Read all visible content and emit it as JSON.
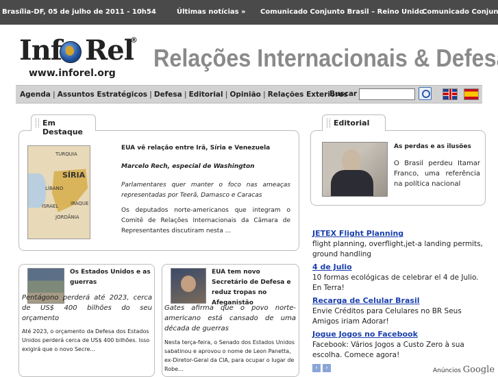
{
  "topbar": {
    "date": "Brasília-DF, 05 de julho de 2011 - 10h54",
    "ultimas": "Últimas notícias »",
    "news1": "Comunicado Conjunto Brasil – Reino Unido",
    "news2": "Comunicado Conjunto"
  },
  "header": {
    "logo_text": "InfoRel",
    "logo_reg": "®",
    "logo_url": "www.inforel.org",
    "title": "Relações Internacionais & Defesa"
  },
  "nav": {
    "items": [
      "Agenda",
      "Assuntos Estratégicos",
      "Defesa",
      "Editorial",
      "Opinião",
      "Relações Exteriores"
    ],
    "search_label": "Buscar",
    "search_value": ""
  },
  "destaque": {
    "tab": "Em Destaque",
    "map_labels": {
      "turquia": "TURQUIA",
      "siria": "SÍRIA",
      "libano": "LÍBANO",
      "israel": "ISRAEL",
      "iraque": "IRAQUE",
      "jordania": "JORDÂNIA"
    },
    "headline": "EUA vê relação entre Irã, Síria e Venezuela",
    "author": "Marcelo Rech, especial de Washington",
    "lead": "Parlamentares quer manter o foco nas ameaças representadas por Teerã, Damasco e Caracas",
    "body": "Os deputados norte-americanos que integram o Comitê de Relações Internacionais da Câmara de Representantes discutiram nesta ..."
  },
  "editorial": {
    "tab": "Editorial",
    "headline": "As perdas e as ilusões",
    "body": "O Brasil perdeu Itamar Franco, uma referência na política nacional"
  },
  "card1": {
    "headline": "Os Estados Unidos e as guerras",
    "lead": "Pentágono perderá até 2023, cerca de US$ 400 bilhões do seu orçamento",
    "body": "Até 2023, o orçamento da Defesa dos Estados Unidos perderá cerca de US$ 400 bilhões. Isso exigirá que o novo Secre..."
  },
  "card2": {
    "headline": "EUA tem novo Secretário de Defesa e reduz tropas no Afeganistão",
    "lead": "Gates afirma que o povo norte-americano está cansado de uma década de guerras",
    "body": "Nesta terça-feira, o Senado dos Estados Unidos sabatinou e aprovou o nome de Leon Panetta, ex-Diretor-Geral da CIA, para ocupar o lugar de Robe..."
  },
  "ads": [
    {
      "title": "JETEX Flight Planning",
      "desc": "flight planning, overflight,jet-a landing permits, ground handling"
    },
    {
      "title": "4 de Julio",
      "desc": "10 formas ecológicas de celebrar el 4 de Julio. En Terra!"
    },
    {
      "title": "Recarga de Celular Brasil",
      "desc": "Envie Créditos para Celulares no BR Seus Amigos iriam Adorar!"
    },
    {
      "title": "Jogue Jogos no Facebook",
      "desc": "Facebook: Vários Jogos a Custo Zero à sua escolha. Comece agora!"
    }
  ],
  "ads_footer": {
    "anuncios": "Anúncios",
    "google": "Google"
  }
}
